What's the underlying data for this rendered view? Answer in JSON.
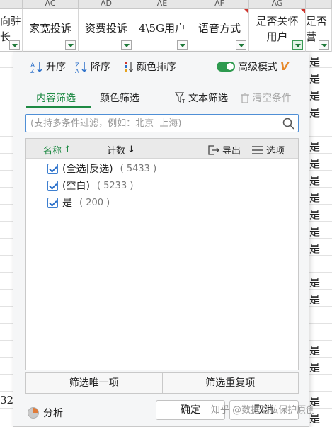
{
  "sheet": {
    "column_letters": [
      "",
      "AC",
      "AD",
      "AE",
      "AF",
      "AG",
      ""
    ],
    "headers": [
      "向驻\n长",
      "家宽投诉",
      "资费投诉",
      "4\\5G用户",
      "语音方式",
      "是否关怀\n用户",
      "是否\n营"
    ],
    "right_col_values": [
      "是",
      "是",
      "是",
      "是",
      "是",
      "是",
      "是",
      "是",
      "是",
      "是",
      "是",
      "是",
      "是",
      "是",
      "是",
      "是",
      "是"
    ],
    "left_col_value": "32"
  },
  "toolbar": {
    "asc_label": "升序",
    "desc_label": "降序",
    "color_sort_label": "颜色排序",
    "advanced_label": "高级模式",
    "vip_mark": "V"
  },
  "tabs": {
    "content_filter": "内容筛选",
    "color_filter": "颜色筛选",
    "text_filter": "文本筛选",
    "clear_conditions": "清空条件"
  },
  "search": {
    "placeholder": "(支持多条件过滤，例如：北京  上海)"
  },
  "list": {
    "col_name": "名称",
    "col_count": "计数",
    "export_label": "导出",
    "options_label": "选项",
    "items": [
      {
        "part1": "(全选",
        "sep": "|",
        "part2": "反选)",
        "count": "( 5433 )"
      },
      {
        "label": "(空白)",
        "count": "( 5233 )"
      },
      {
        "label": "是",
        "count": "( 200 )"
      }
    ]
  },
  "buttons": {
    "unique_label": "筛选唯一项",
    "duplicate_label": "筛选重复项",
    "analyze_label": "分析",
    "ok_label": "确定",
    "cancel_label": "取消"
  },
  "watermark": "知乎 @数据隐私保护原创"
}
